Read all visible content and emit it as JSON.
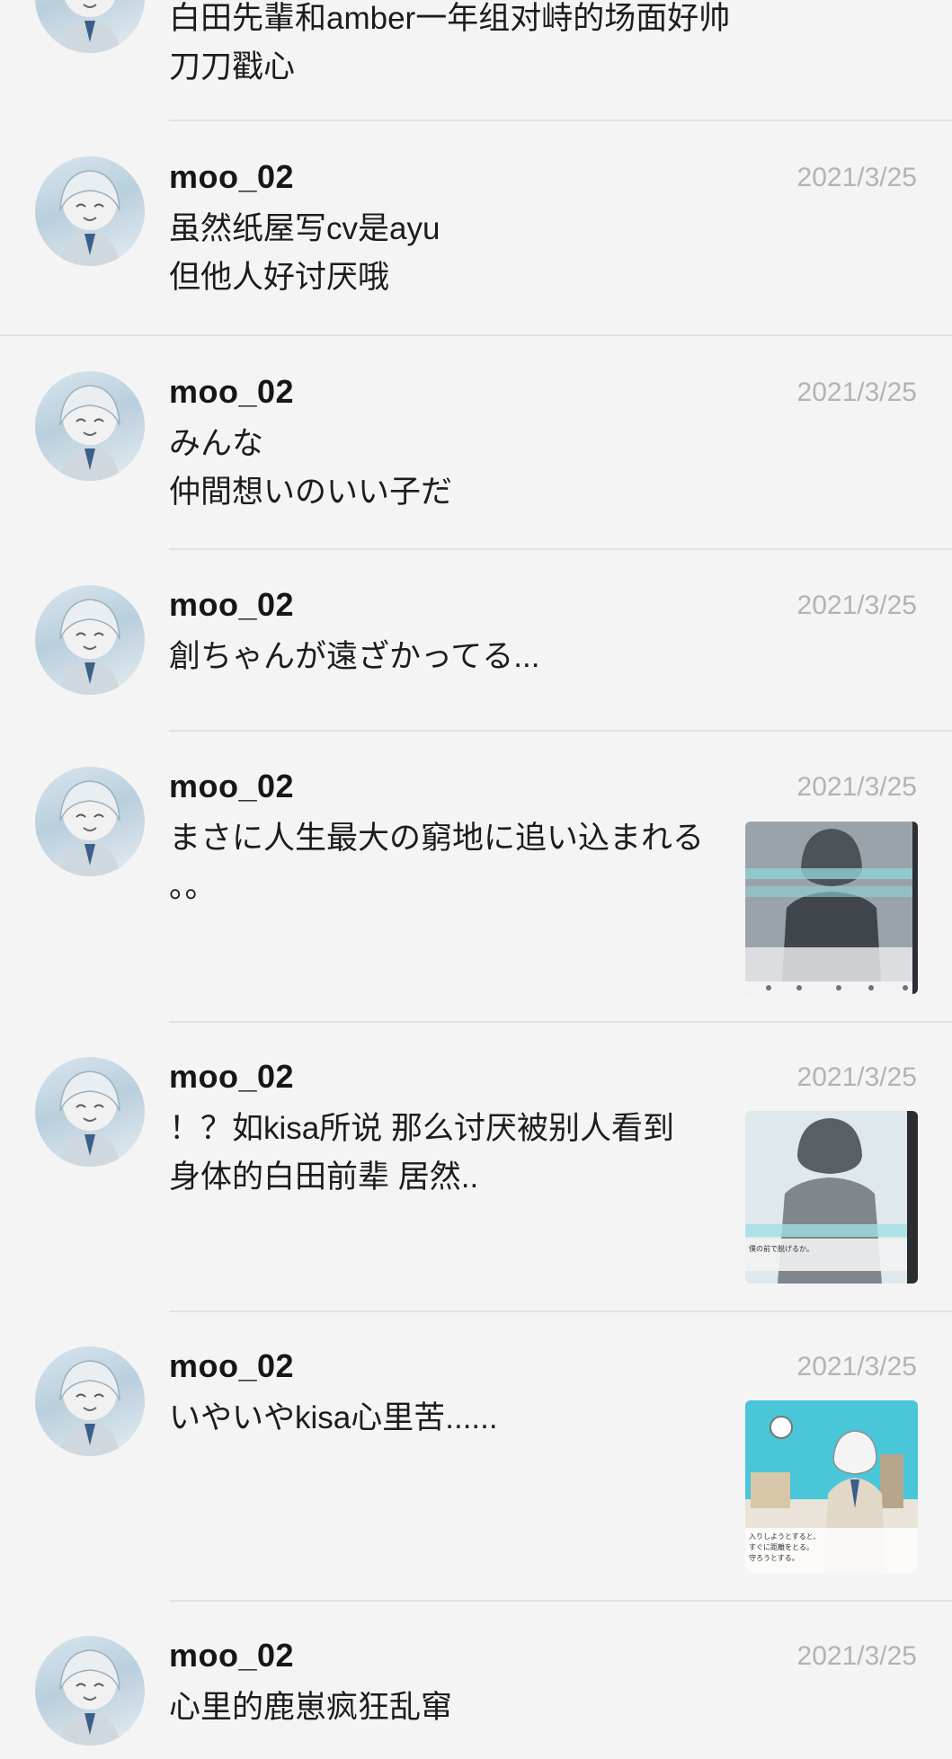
{
  "posts": [
    {
      "username": "",
      "date": "",
      "text": "白田先輩和amber一年组对峙的场面好帅\n刀刀戳心"
    },
    {
      "username": "moo_02",
      "date": "2021/3/25",
      "text": "虽然纸屋写cv是ayu\n但他人好讨厌哦"
    },
    {
      "username": "moo_02",
      "date": "2021/3/25",
      "text": "みんな\n仲間想いのいい子だ"
    },
    {
      "username": "moo_02",
      "date": "2021/3/25",
      "text": "創ちゃんが遠ざかってる..."
    },
    {
      "username": "moo_02",
      "date": "2021/3/25",
      "text": "まさに人生最大の窮地に追い込まれる\n。。",
      "image": {
        "kind": "screenshot-dark-figure",
        "caption": "",
        "choices": [
          "",
          ""
        ]
      }
    },
    {
      "username": "moo_02",
      "date": "2021/3/25",
      "text": "！？如kisa所说 那么讨厌被别人看到\n身体的白田前辈 居然..",
      "image": {
        "kind": "screenshot-light-figure",
        "caption": "僕の前で脱げるか。"
      }
    },
    {
      "username": "moo_02",
      "date": "2021/3/25",
      "text": "いやいやkisa心里苦......",
      "image": {
        "kind": "screenshot-room",
        "caption": "入りしようとすると、\nすぐに距離をとる。\n守ろうとする。"
      }
    },
    {
      "username": "moo_02",
      "date": "2021/3/25",
      "text": "心里的鹿崽疯狂乱窜"
    }
  ]
}
